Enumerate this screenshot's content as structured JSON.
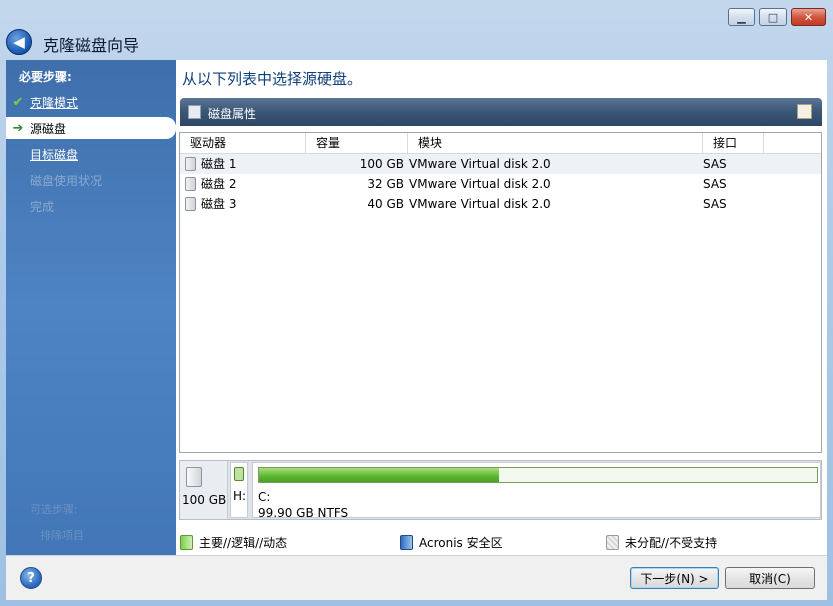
{
  "window": {
    "title": "克隆磁盘向导",
    "min_label": "▁",
    "max_label": "□",
    "close_label": "✕",
    "back_label": "◀"
  },
  "sidebar": {
    "heading": "必要步骤:",
    "steps": [
      {
        "label": "克隆模式",
        "state": "done",
        "mark": "✔"
      },
      {
        "label": "源磁盘",
        "state": "current",
        "mark": "➔"
      },
      {
        "label": "目标磁盘",
        "state": "link"
      },
      {
        "label": "磁盘使用状况",
        "state": "dim"
      },
      {
        "label": "完成",
        "state": "dim"
      }
    ],
    "footer_1": "可选步骤:",
    "footer_2": "排除项目"
  },
  "main": {
    "title": "从以下列表中选择源硬盘。",
    "toolbar_label": "磁盘属性"
  },
  "table": {
    "headers": [
      "驱动器",
      "容量",
      "模块",
      "接口"
    ],
    "rows": [
      {
        "drive": "磁盘 1",
        "capacity": "100 GB",
        "model": "VMware Virtual disk 2.0",
        "interface": "SAS"
      },
      {
        "drive": "磁盘 2",
        "capacity": "32 GB",
        "model": "VMware Virtual disk 2.0",
        "interface": "SAS"
      },
      {
        "drive": "磁盘 3",
        "capacity": "40 GB",
        "model": "VMware Virtual disk 2.0",
        "interface": "SAS"
      }
    ]
  },
  "diskmap": {
    "disk_size": "100 GB",
    "partition_letter": "H:",
    "volume_name": "C:",
    "volume_info": "99.90 GB  NTFS",
    "used_fraction": 0.43
  },
  "legend": {
    "primary": "主要//逻辑//动态",
    "acronis": "Acronis 安全区",
    "unallocated": "未分配//不受支持"
  },
  "colors": {
    "primary": "#5bb52f",
    "acronis": "#2f6fc1",
    "unallocated": "#c8c8c8",
    "title": "#0f3f7a"
  },
  "footer": {
    "help_label": "?",
    "next_label": "下一步(N) >",
    "cancel_label": "取消(C)"
  }
}
